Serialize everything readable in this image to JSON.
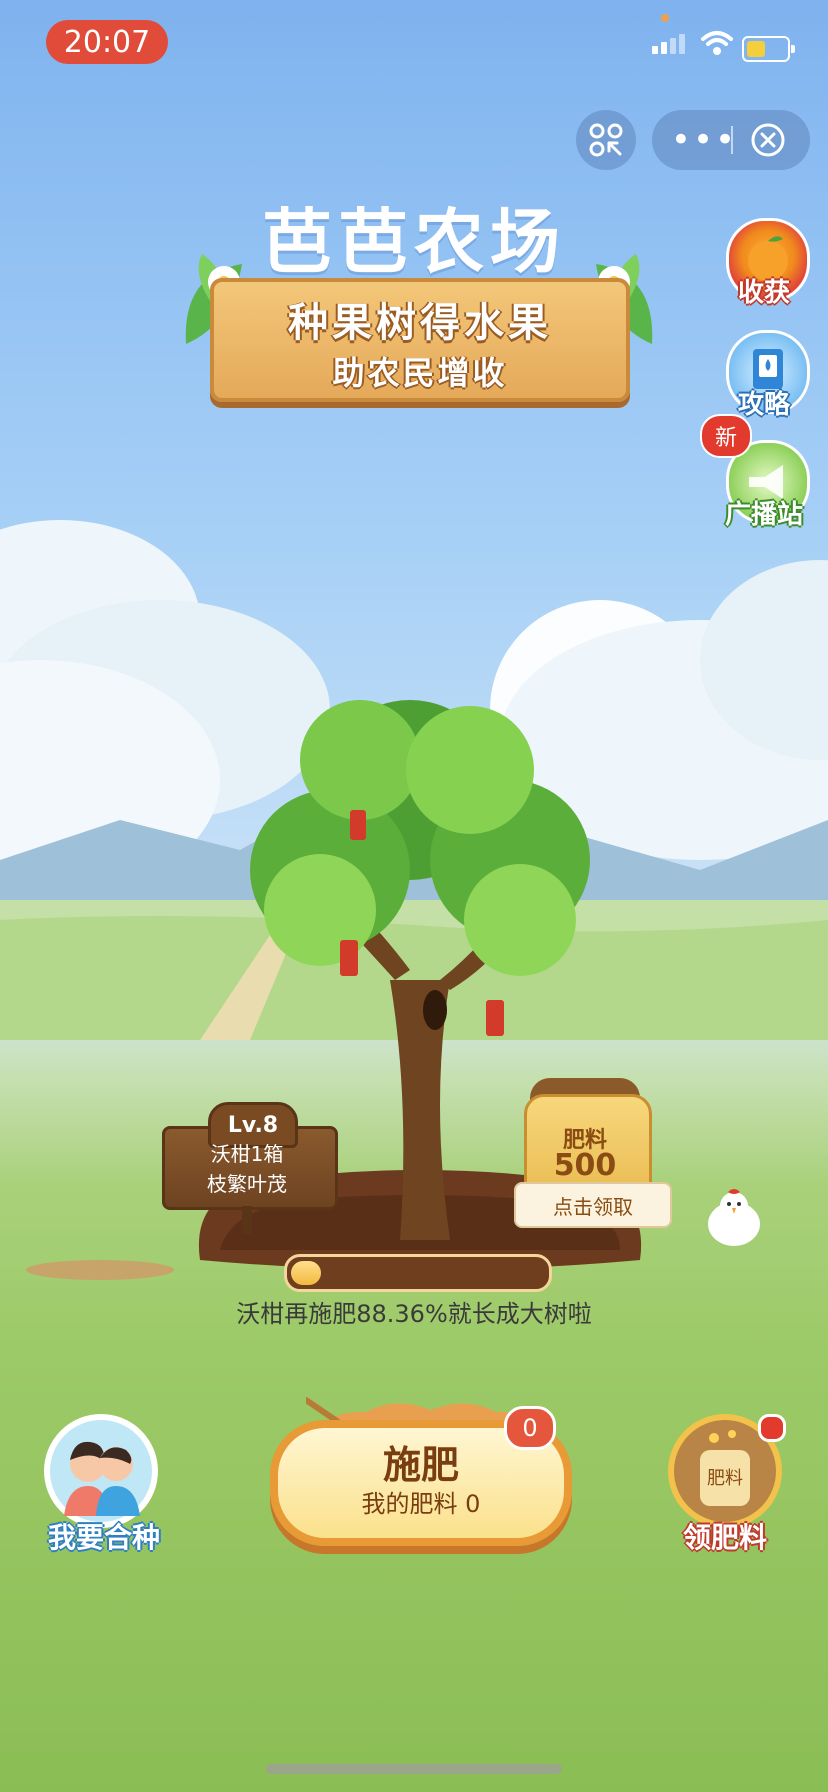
{
  "status_bar": {
    "time": "20:07"
  },
  "header": {
    "app_title": "芭芭农场",
    "banner_line1": "种果树得水果",
    "banner_line2": "助农民增收"
  },
  "side_buttons": [
    {
      "label": "收获",
      "icon": "orange-fruit-icon"
    },
    {
      "label": "攻略",
      "icon": "guide-book-icon"
    },
    {
      "label": "广播站",
      "icon": "megaphone-icon",
      "badge": "新"
    }
  ],
  "tree": {
    "level": "Lv.8",
    "fruit": "沃柑1箱",
    "stage": "枝繁叶茂",
    "progress_text": "沃柑再施肥88.36%就长成大树啦",
    "progress_fraction": 0.1164
  },
  "fertilizer_bag": {
    "label": "肥料",
    "amount": "500",
    "action": "点击领取"
  },
  "bottom": {
    "coplant_label": "我要合种",
    "fertilize_title": "施肥",
    "fertilize_sub": "我的肥料 0",
    "fertilize_badge": "0",
    "get_fertilizer_label": "领肥料",
    "get_fertilizer_bag_text": "肥料"
  },
  "colors": {
    "time_pill": "#e04b3a",
    "accent_orange": "#e79a36",
    "badge_red": "#e23b2e"
  }
}
